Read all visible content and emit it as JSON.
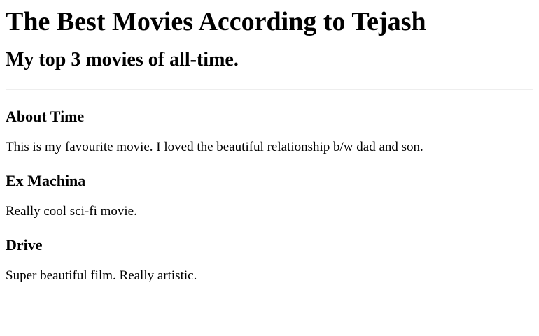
{
  "page": {
    "title": "The Best Movies According to Tejash",
    "subtitle": "My top 3 movies of all-time."
  },
  "movies": [
    {
      "title": "About Time",
      "description": "This is my favourite movie. I loved the beautiful relationship b/w dad and son."
    },
    {
      "title": "Ex Machina",
      "description": "Really cool sci-fi movie."
    },
    {
      "title": "Drive",
      "description": "Super beautiful film. Really artistic."
    }
  ]
}
